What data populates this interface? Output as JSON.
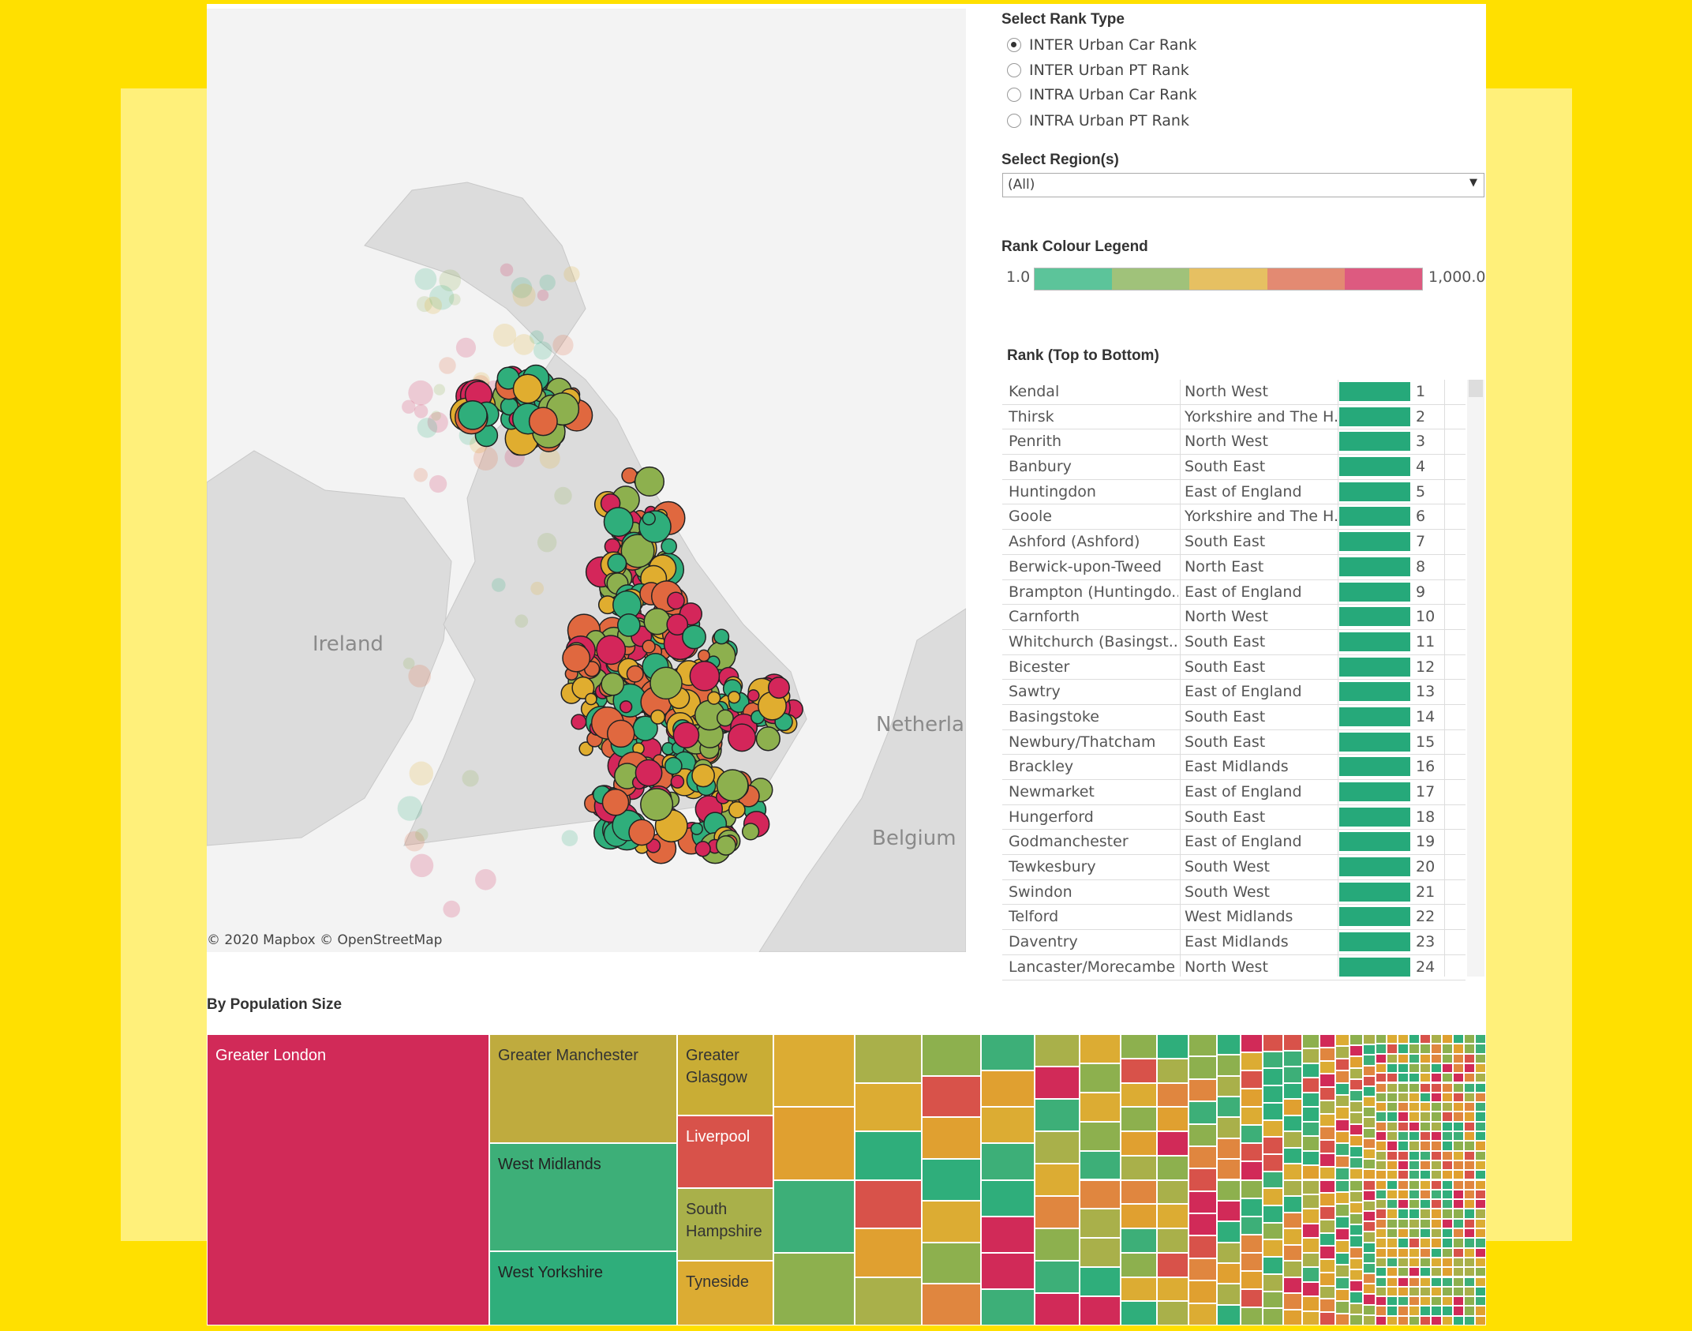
{
  "colors": {
    "background": "#ffe000",
    "band": "#fff07a",
    "rank_green": "#26a97a"
  },
  "map": {
    "labels": {
      "ireland": "Ireland",
      "netherlands": "Netherla",
      "belgium": "Belgium"
    },
    "attribution": "© 2020 Mapbox  © OpenStreetMap",
    "marker_palette": [
      "#2fae7b",
      "#8db04e",
      "#e0ad2f",
      "#e0683f",
      "#d4265a"
    ]
  },
  "rank_type": {
    "title": "Select Rank Type",
    "options": [
      {
        "label": "INTER Urban Car Rank",
        "selected": true
      },
      {
        "label": "INTER Urban PT Rank",
        "selected": false
      },
      {
        "label": "INTRA Urban Car Rank",
        "selected": false
      },
      {
        "label": "INTRA Urban PT Rank",
        "selected": false
      }
    ]
  },
  "region": {
    "title": "Select Region(s)",
    "value": "(All)"
  },
  "legend": {
    "title": "Rank Colour Legend",
    "min": "1.0",
    "max": "1,000.0",
    "colors": [
      "#5cc49a",
      "#a0c27a",
      "#e6c062",
      "#e38a72",
      "#dd5a80"
    ]
  },
  "rank_table": {
    "title": "Rank (Top to Bottom)",
    "rows": [
      {
        "name": "Kendal",
        "region": "North West",
        "rank": "1"
      },
      {
        "name": "Thirsk",
        "region": "Yorkshire and The H..",
        "rank": "2"
      },
      {
        "name": "Penrith",
        "region": "North West",
        "rank": "3"
      },
      {
        "name": "Banbury",
        "region": "South East",
        "rank": "4"
      },
      {
        "name": "Huntingdon",
        "region": "East of England",
        "rank": "5"
      },
      {
        "name": "Goole",
        "region": "Yorkshire and The H..",
        "rank": "6"
      },
      {
        "name": "Ashford (Ashford)",
        "region": "South East",
        "rank": "7"
      },
      {
        "name": "Berwick-upon-Tweed",
        "region": "North East",
        "rank": "8"
      },
      {
        "name": "Brampton (Huntingdo..",
        "region": "East of England",
        "rank": "9"
      },
      {
        "name": "Carnforth",
        "region": "North West",
        "rank": "10"
      },
      {
        "name": "Whitchurch (Basingst..",
        "region": "South East",
        "rank": "11"
      },
      {
        "name": "Bicester",
        "region": "South East",
        "rank": "12"
      },
      {
        "name": "Sawtry",
        "region": "East of England",
        "rank": "13"
      },
      {
        "name": "Basingstoke",
        "region": "South East",
        "rank": "14"
      },
      {
        "name": "Newbury/Thatcham",
        "region": "South East",
        "rank": "15"
      },
      {
        "name": "Brackley",
        "region": "East Midlands",
        "rank": "16"
      },
      {
        "name": "Newmarket",
        "region": "East of England",
        "rank": "17"
      },
      {
        "name": "Hungerford",
        "region": "South East",
        "rank": "18"
      },
      {
        "name": "Godmanchester",
        "region": "East of England",
        "rank": "19"
      },
      {
        "name": "Tewkesbury",
        "region": "South West",
        "rank": "20"
      },
      {
        "name": "Swindon",
        "region": "South West",
        "rank": "21"
      },
      {
        "name": "Telford",
        "region": "West Midlands",
        "rank": "22"
      },
      {
        "name": "Daventry",
        "region": "East Midlands",
        "rank": "23"
      },
      {
        "name": "Lancaster/Morecambe",
        "region": "North West",
        "rank": "24"
      }
    ]
  },
  "treemap": {
    "title": "By Population Size",
    "tiles": [
      {
        "label": "Greater London",
        "color": "#d12a58",
        "text": "#ffffff"
      },
      {
        "label": "Greater Manchester",
        "color": "#bfab3e",
        "text": "#333333"
      },
      {
        "label": "West Midlands",
        "color": "#3daf78",
        "text": "#222222"
      },
      {
        "label": "West Yorkshire",
        "color": "#2fae7b",
        "text": "#222222"
      },
      {
        "label": "Greater\nGlasgow",
        "color": "#c9ad35",
        "text": "#333333"
      },
      {
        "label": "Liverpool",
        "color": "#d8524a",
        "text": "#ffffff"
      },
      {
        "label": "South\nHampshire",
        "color": "#a9b04a",
        "text": "#333333"
      },
      {
        "label": "Tyneside",
        "color": "#dcac33",
        "text": "#333333"
      }
    ],
    "palette": [
      "#2fae7b",
      "#3daf78",
      "#8db04e",
      "#a9b04a",
      "#dcac33",
      "#e0a030",
      "#e0863f",
      "#d8524a",
      "#d12a58"
    ]
  }
}
